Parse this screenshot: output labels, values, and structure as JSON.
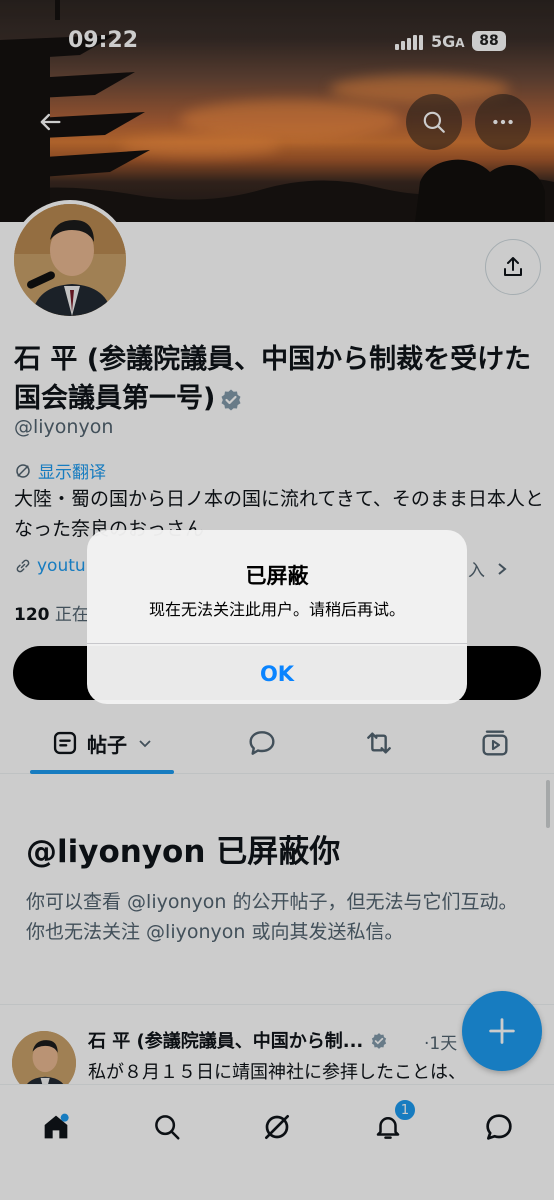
{
  "status_bar": {
    "time": "09:22",
    "network": "5G",
    "network_suffix": "A",
    "battery": "88"
  },
  "header": {
    "back_icon": "arrow-left-icon",
    "search_icon": "search-icon",
    "more_icon": "ellipsis-icon"
  },
  "profile": {
    "name": "石 平 (参議院議員、中国から制裁を受けた国会議員第一号)",
    "handle": "@liyonyon",
    "translate_label": "显示翻译",
    "bio": "大陸・蜀の国から日ノ本の国に流れてきて、そのまま日本人となった奈良のおっさん",
    "link_text": "youtu",
    "joined_fragment": "入",
    "following_count": "120",
    "following_label": "正在"
  },
  "tabs": [
    {
      "label": "帖子",
      "icon": "post-icon",
      "active": true
    },
    {
      "label": "",
      "icon": "reply-icon"
    },
    {
      "label": "",
      "icon": "retweet-icon"
    },
    {
      "label": "",
      "icon": "video-icon"
    }
  ],
  "blocked": {
    "title": "@liyonyon 已屏蔽你",
    "description": "你可以查看 @liyonyon 的公开帖子，但无法与它们互动。你也无法关注 @liyonyon 或向其发送私信。"
  },
  "tweet": {
    "name": "石 平 (参議院議員、中国から制...",
    "time": "·1天",
    "text": "私が８月１５日に靖国神社に参拝したことは、"
  },
  "bottom_nav": {
    "notifications_badge": "1"
  },
  "alert": {
    "title": "已屏蔽",
    "message": "现在无法关注此用户。请稍后再试。",
    "ok_label": "OK"
  },
  "colors": {
    "accent": "#1d9bf0",
    "ok_blue": "#0a84ff",
    "text": "#0f1419",
    "muted": "#536471"
  }
}
